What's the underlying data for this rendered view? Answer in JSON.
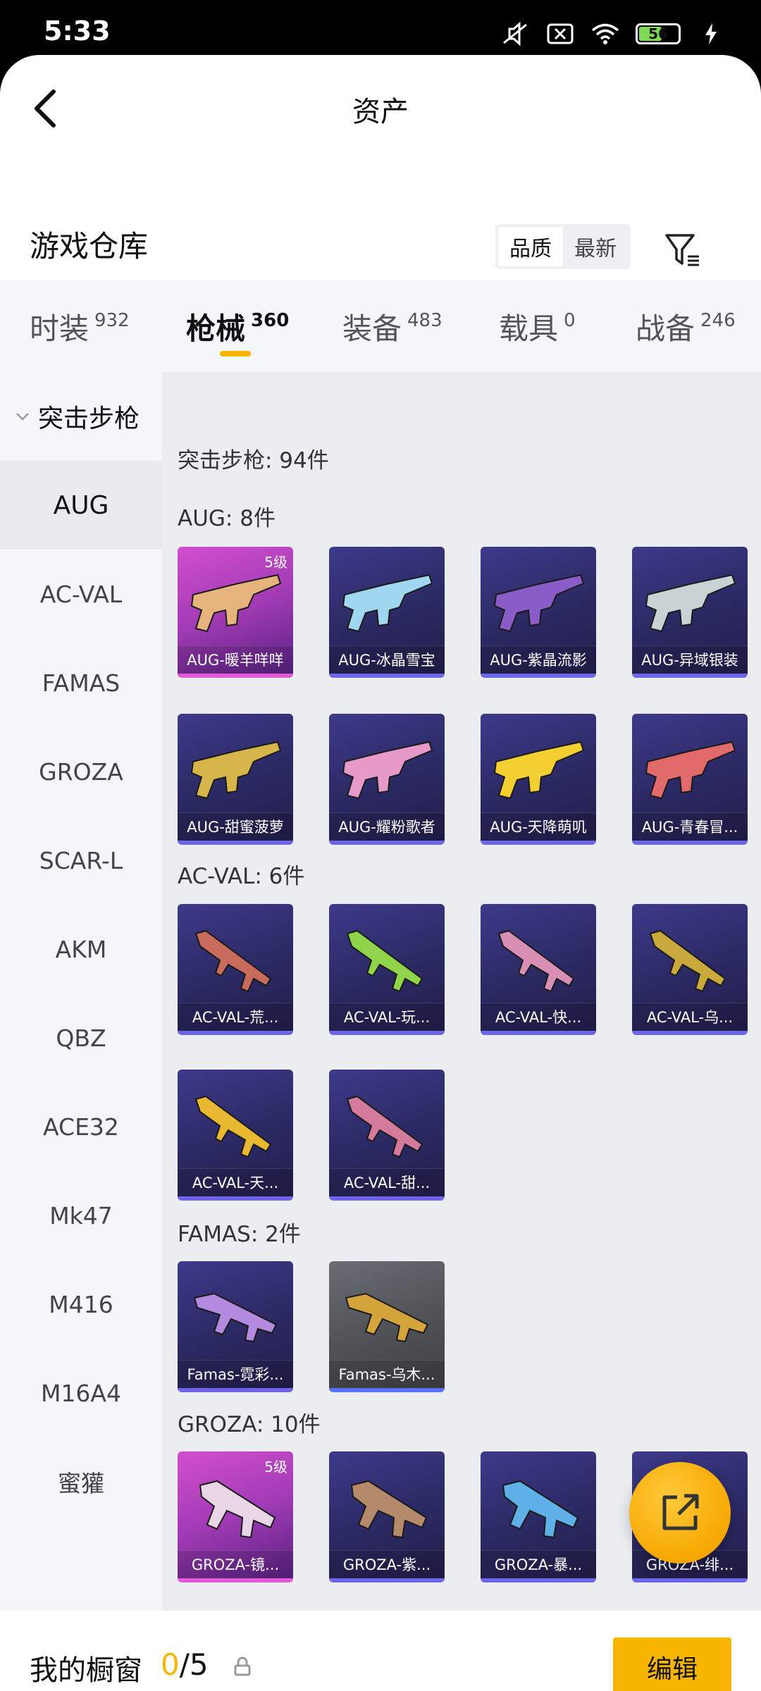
{
  "status_bar": {
    "time": "5:33",
    "battery": "56"
  },
  "header": {
    "title": "资产"
  },
  "section": {
    "title": "游戏仓库",
    "sort_options": [
      "品质",
      "最新"
    ]
  },
  "tabs": [
    {
      "name": "时装",
      "count": "932"
    },
    {
      "name": "枪械",
      "count": "360"
    },
    {
      "name": "装备",
      "count": "483"
    },
    {
      "name": "载具",
      "count": "0"
    },
    {
      "name": "战备",
      "count": "246"
    }
  ],
  "sidebar": {
    "header": "突击步枪",
    "items": [
      "AUG",
      "AC-VAL",
      "FAMAS",
      "GROZA",
      "SCAR-L",
      "AKM",
      "QBZ",
      "ACE32",
      "Mk47",
      "M416",
      "M16A4",
      "蜜獾"
    ]
  },
  "content": {
    "summary": "突击步枪: 94件",
    "groups": [
      {
        "title": "AUG: 8件",
        "items": [
          {
            "name": "AUG-暖羊咩咩",
            "level": "5级",
            "gun": "#e6b37c"
          },
          {
            "name": "AUG-冰晶雪宝",
            "gun": "#9fd6f0"
          },
          {
            "name": "AUG-紫晶流影",
            "gun": "#8a5cc8"
          },
          {
            "name": "AUG-异域银装",
            "gun": "#c9d3d6"
          },
          {
            "name": "AUG-甜蜜菠萝",
            "gun": "#d6b54a"
          },
          {
            "name": "AUG-耀粉歌者",
            "gun": "#e79ac9"
          },
          {
            "name": "AUG-天降萌叽",
            "gun": "#f3cf32"
          },
          {
            "name": "AUG-青春冒...",
            "gun": "#e36a6a"
          }
        ]
      },
      {
        "title": "AC-VAL: 6件",
        "items": [
          {
            "name": "AC-VAL-荒...",
            "gun": "#c86a5c"
          },
          {
            "name": "AC-VAL-玩...",
            "gun": "#8fd44a"
          },
          {
            "name": "AC-VAL-快...",
            "gun": "#d98fb3"
          },
          {
            "name": "AC-VAL-乌...",
            "gun": "#c9a83c"
          },
          {
            "name": "AC-VAL-天...",
            "gun": "#e8b830"
          },
          {
            "name": "AC-VAL-甜...",
            "gun": "#d47a9a"
          }
        ]
      },
      {
        "title": "FAMAS: 2件",
        "items": [
          {
            "name": "Famas-霓彩...",
            "gun": "#b48ae0"
          },
          {
            "name": "Famas-乌木...",
            "gun": "#d2a43a"
          }
        ]
      },
      {
        "title": "GROZA: 10件",
        "items": [
          {
            "name": "GROZA-镜...",
            "level": "5级",
            "gun": "#e8d6e6"
          },
          {
            "name": "GROZA-紫...",
            "gun": "#b48a6a"
          },
          {
            "name": "GROZA-暴...",
            "gun": "#5fb0e8"
          },
          {
            "name": "GROZA-绯...",
            "gun": "#d85a6a"
          }
        ]
      }
    ]
  },
  "bottom": {
    "label": "我的橱窗",
    "current": "0",
    "total": "/5",
    "edit": "编辑"
  },
  "colors": {
    "accent": "#f7b500",
    "epic": "#6e66e8",
    "legendary": "#e35ad9"
  }
}
